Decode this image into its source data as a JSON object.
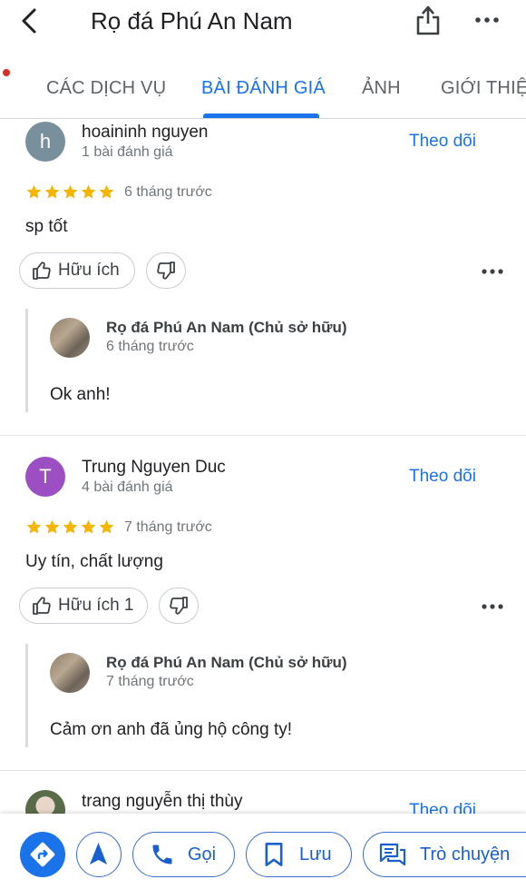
{
  "header": {
    "title": "Rọ đá Phú An Nam"
  },
  "tabs": [
    {
      "label": "CÁC DỊCH VỤ"
    },
    {
      "label": "BÀI ĐÁNH GIÁ"
    },
    {
      "label": "ẢNH"
    },
    {
      "label": "GIỚI THIỆ"
    }
  ],
  "reviews": [
    {
      "avatar_letter": "h",
      "avatar_color": "#78909c",
      "name": "hoaininh nguyen",
      "review_count": "1 bài đánh giá",
      "follow_label": "Theo dõi",
      "rating": 5,
      "time": "6 tháng trước",
      "text": "sp tốt",
      "helpful_label": "Hữu ích",
      "owner_reply": {
        "name": "Rọ đá Phú An Nam (Chủ sở hữu)",
        "time": "6 tháng trước",
        "text": "Ok anh!"
      }
    },
    {
      "avatar_letter": "T",
      "avatar_color": "#9c4fc2",
      "name": "Trung Nguyen Duc",
      "review_count": "4 bài đánh giá",
      "follow_label": "Theo dõi",
      "rating": 5,
      "time": "7 tháng trước",
      "text": "Uy tín, chất lượng",
      "helpful_label": "Hữu ích 1",
      "owner_reply": {
        "name": "Rọ đá Phú An Nam (Chủ sở hữu)",
        "time": "7 tháng trước",
        "text": "Cảm ơn anh đã ủng hộ công ty!"
      }
    },
    {
      "name": "trang nguyễn thị thùy",
      "follow_label": "Theo dõi"
    }
  ],
  "bottom_bar": {
    "call_label": "Gọi",
    "save_label": "Lưu",
    "chat_label": "Trò chuyện"
  },
  "colors": {
    "accent": "#1a73e8",
    "star": "#f4b400"
  }
}
